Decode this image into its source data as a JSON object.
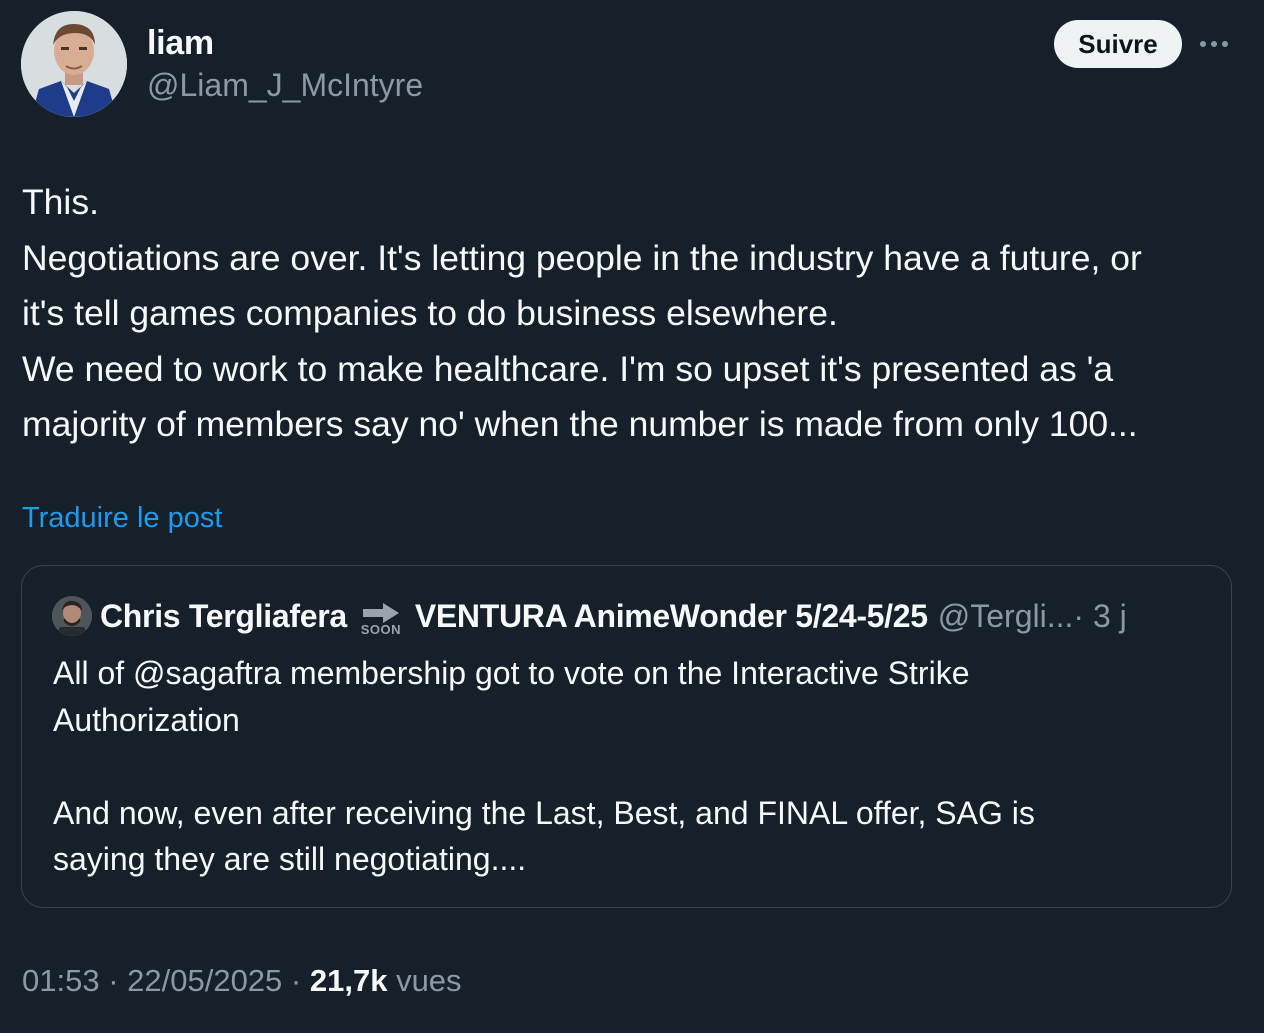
{
  "author": {
    "name": "liam",
    "handle": "@Liam_J_McIntyre",
    "avatar_icon": "avatar-photo"
  },
  "actions": {
    "follow_label": "Suivre",
    "more_icon": "more-horizontal-icon"
  },
  "tweet": {
    "lines": [
      "This.",
      "Negotiations are over. It's letting people in the industry have a future, or",
      "it's tell games companies to do business elsewhere.",
      "We need to work to make healthcare. I'm so upset it's presented as 'a",
      "majority of members say no' when the number is made from only 100..."
    ],
    "translate_label": "Traduire le post"
  },
  "quote": {
    "name_part1": "Chris Tergliafera",
    "soon_label": "SOON",
    "name_part2": "VENTURA AnimeWonder 5/24-5/25",
    "handle": "@Tergli...",
    "time": " · 3 j",
    "lines": [
      "All of @sagaftra membership got to vote on the Interactive Strike",
      "Authorization",
      "",
      "And now, even after receiving the Last, Best, and FINAL offer, SAG is",
      "saying they are still negotiating...."
    ]
  },
  "meta": {
    "time": "01:53",
    "date": "22/05/2025",
    "separator": " · ",
    "views_count": "21,7k",
    "views_label": "vues"
  },
  "colors": {
    "background": "#15202b",
    "accent": "#1d9bf0",
    "secondary_text": "#8b98a5",
    "border": "#38444d"
  }
}
